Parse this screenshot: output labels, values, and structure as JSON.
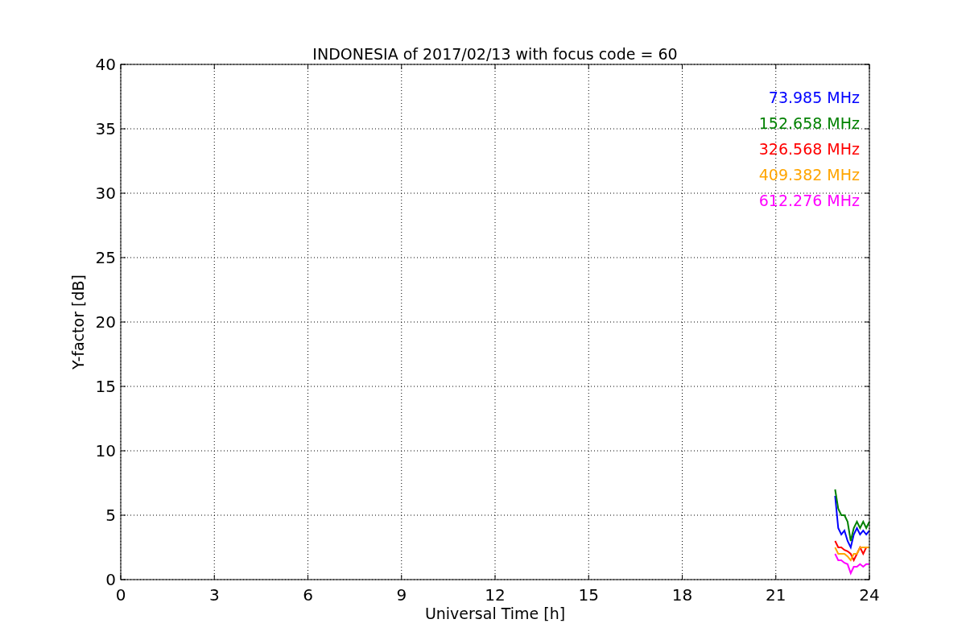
{
  "chart_data": {
    "type": "line",
    "title": "INDONESIA of 2017/02/13 with focus code = 60",
    "xlabel": "Universal Time [h]",
    "ylabel": "Y-factor [dB]",
    "x": [
      22.9,
      23.0,
      23.1,
      23.2,
      23.3,
      23.4,
      23.5,
      23.6,
      23.7,
      23.8,
      23.9,
      24.0
    ],
    "series": [
      {
        "name": "73.985 MHz",
        "color": "#0000ff",
        "values": [
          6.5,
          4.0,
          3.5,
          3.8,
          3.0,
          2.5,
          3.5,
          4.0,
          3.5,
          3.8,
          3.5,
          3.8
        ]
      },
      {
        "name": "152.658 MHz",
        "color": "#008000",
        "values": [
          7.0,
          5.5,
          5.0,
          5.0,
          4.5,
          3.0,
          4.0,
          4.5,
          4.0,
          4.5,
          4.0,
          4.5
        ]
      },
      {
        "name": "326.568 MHz",
        "color": "#ff0000",
        "values": [
          3.0,
          2.5,
          2.5,
          2.3,
          2.2,
          2.0,
          1.5,
          2.0,
          2.5,
          2.0,
          2.5,
          2.5
        ]
      },
      {
        "name": "409.382 MHz",
        "color": "#ffa500",
        "values": [
          2.5,
          2.0,
          2.0,
          2.0,
          1.8,
          1.5,
          2.0,
          2.0,
          2.5,
          2.5,
          2.5,
          2.5
        ]
      },
      {
        "name": "612.276 MHz",
        "color": "#ff00ff",
        "values": [
          2.0,
          1.5,
          1.5,
          1.3,
          1.2,
          0.5,
          1.0,
          1.0,
          1.2,
          1.0,
          1.2,
          1.2
        ]
      }
    ],
    "xlim": [
      0,
      24
    ],
    "ylim": [
      0,
      40
    ],
    "xticks": [
      0,
      3,
      6,
      9,
      12,
      15,
      18,
      21,
      24
    ],
    "yticks": [
      0,
      5,
      10,
      15,
      20,
      25,
      30,
      35,
      40
    ],
    "grid": true
  }
}
